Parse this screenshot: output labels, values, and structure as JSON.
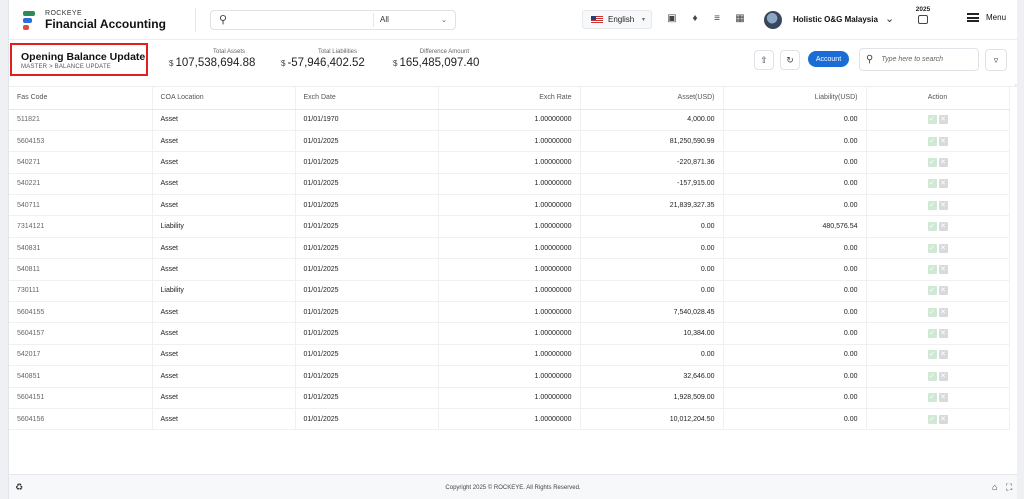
{
  "app": {
    "brand_small": "ROCKEYE",
    "brand_big": "Financial Accounting"
  },
  "topbar": {
    "search_filter": "All",
    "language": "English",
    "company": "Holistic O&G Malaysia",
    "year": "2025",
    "menu_label": "Menu",
    "icons": [
      "search-icon",
      "bookmark-icon",
      "bell-icon",
      "checklist-icon",
      "grid-icon",
      "calendar-icon",
      "hamburger-icon"
    ]
  },
  "page": {
    "title": "Opening Balance Update",
    "breadcrumb": "MASTER  >  BALANCE UPDATE",
    "stats": [
      {
        "label": "Total Assets",
        "currency": "$",
        "value": "107,538,694.88"
      },
      {
        "label": "Total Liabilities",
        "currency": "$",
        "value": "-57,946,402.52"
      },
      {
        "label": "Difference Amount",
        "currency": "$",
        "value": "165,485,097.40"
      }
    ],
    "account_button": "Account",
    "search_placeholder": "Type here to search"
  },
  "table": {
    "columns": [
      "Fas Code",
      "COA Location",
      "Exch Date",
      "Exch Rate",
      "Asset(USD)",
      "Liability(USD)",
      "Action"
    ],
    "rows": [
      [
        "511821",
        "Asset",
        "01/01/1970",
        "1.00000000",
        "4,000.00",
        "0.00"
      ],
      [
        "5604153",
        "Asset",
        "01/01/2025",
        "1.00000000",
        "81,250,590.99",
        "0.00"
      ],
      [
        "540271",
        "Asset",
        "01/01/2025",
        "1.00000000",
        "-220,871.36",
        "0.00"
      ],
      [
        "540221",
        "Asset",
        "01/01/2025",
        "1.00000000",
        "-157,915.00",
        "0.00"
      ],
      [
        "540711",
        "Asset",
        "01/01/2025",
        "1.00000000",
        "21,839,327.35",
        "0.00"
      ],
      [
        "7314121",
        "Liability",
        "01/01/2025",
        "1.00000000",
        "0.00",
        "480,576.54"
      ],
      [
        "540831",
        "Asset",
        "01/01/2025",
        "1.00000000",
        "0.00",
        "0.00"
      ],
      [
        "540811",
        "Asset",
        "01/01/2025",
        "1.00000000",
        "0.00",
        "0.00"
      ],
      [
        "730111",
        "Liability",
        "01/01/2025",
        "1.00000000",
        "0.00",
        "0.00"
      ],
      [
        "5604155",
        "Asset",
        "01/01/2025",
        "1.00000000",
        "7,540,028.45",
        "0.00"
      ],
      [
        "5604157",
        "Asset",
        "01/01/2025",
        "1.00000000",
        "10,384.00",
        "0.00"
      ],
      [
        "542017",
        "Asset",
        "01/01/2025",
        "1.00000000",
        "0.00",
        "0.00"
      ],
      [
        "540851",
        "Asset",
        "01/01/2025",
        "1.00000000",
        "32,646.00",
        "0.00"
      ],
      [
        "5604151",
        "Asset",
        "01/01/2025",
        "1.00000000",
        "1,928,509.00",
        "0.00"
      ],
      [
        "5604156",
        "Asset",
        "01/01/2025",
        "1.00000000",
        "10,012,204.50",
        "0.00"
      ]
    ]
  },
  "footer": {
    "copyright": "Copyright 2025 © ROCKEYE. All Rights Reserved."
  },
  "colors": {
    "accent": "#1a6dd6",
    "highlight_border": "#e0201d"
  }
}
